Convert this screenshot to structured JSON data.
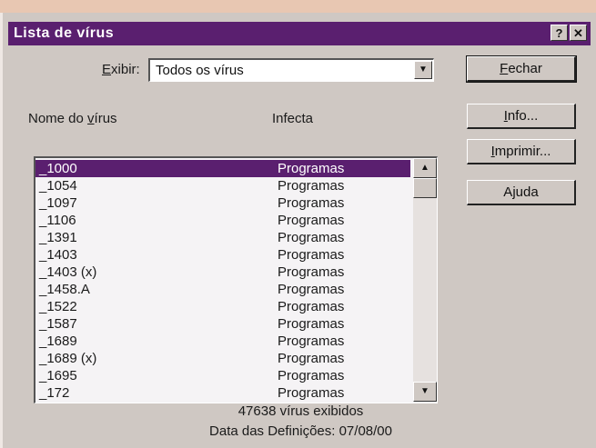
{
  "window": {
    "title": "Lista de vírus",
    "help_label": "?",
    "close_label": "✕"
  },
  "filter": {
    "label_before": "",
    "label_hotkey": "E",
    "label_after": "xibir:",
    "value": "Todos os vírus"
  },
  "columns": {
    "name_before": "Nome do ",
    "name_hotkey": "v",
    "name_after": "írus",
    "infects": "Infecta"
  },
  "buttons": {
    "close_hotkey": "F",
    "close_rest": "echar",
    "info_hotkey": "I",
    "info_rest": "nfo...",
    "print_hotkey": "I",
    "print_rest": "mprimir...",
    "help_before": "A",
    "help_hotkey": "j",
    "help_after": "uda"
  },
  "viruses": [
    {
      "name": "_1000",
      "infects": "Programas",
      "selected": true
    },
    {
      "name": "_1054",
      "infects": "Programas"
    },
    {
      "name": "_1097",
      "infects": "Programas"
    },
    {
      "name": "_1106",
      "infects": "Programas"
    },
    {
      "name": "_1391",
      "infects": "Programas"
    },
    {
      "name": "_1403",
      "infects": "Programas"
    },
    {
      "name": "_1403 (x)",
      "infects": "Programas"
    },
    {
      "name": "_1458.A",
      "infects": "Programas"
    },
    {
      "name": "_1522",
      "infects": "Programas"
    },
    {
      "name": "_1587",
      "infects": "Programas"
    },
    {
      "name": "_1689",
      "infects": "Programas"
    },
    {
      "name": "_1689 (x)",
      "infects": "Programas"
    },
    {
      "name": "_1695",
      "infects": "Programas"
    },
    {
      "name": "_172",
      "infects": "Programas"
    }
  ],
  "status": {
    "count": "47638 vírus exibidos",
    "definitions": "Data das Definições: 07/08/00"
  },
  "colors": {
    "titlebar": "#5a1f6f",
    "selection": "#5a1f6f",
    "dialog": "#cfc8c3"
  }
}
